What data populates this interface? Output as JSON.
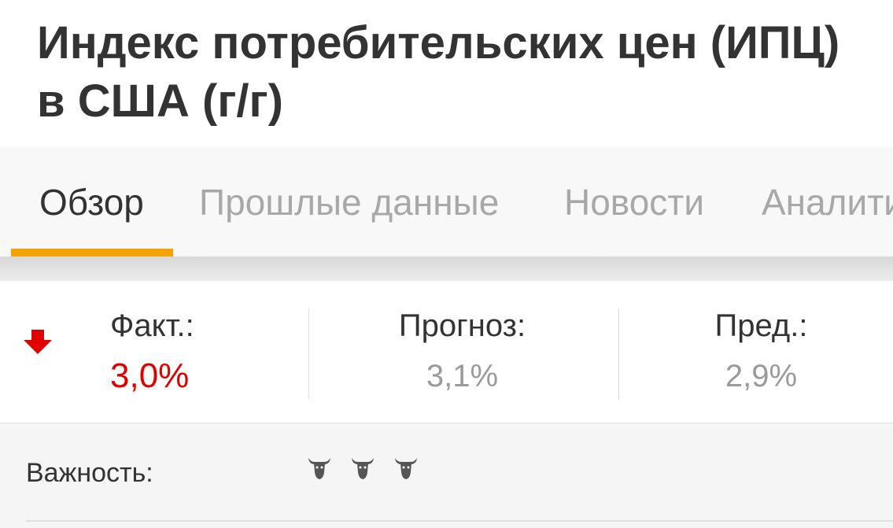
{
  "header": {
    "title_line1": "Индекс потребительских цен (ИПЦ)",
    "title_line2": "в США (г/г)"
  },
  "tabs": [
    {
      "label": "Обзор",
      "active": true
    },
    {
      "label": "Прошлые данные",
      "active": false
    },
    {
      "label": "Новости",
      "active": false
    },
    {
      "label": "Аналитика",
      "active": false
    }
  ],
  "indicator": {
    "direction_icon": "arrow-down-icon",
    "actual_label": "Факт.:",
    "actual_value": "3,0%",
    "forecast_label": "Прогноз:",
    "forecast_value": "3,1%",
    "previous_label": "Пред.:",
    "previous_value": "2,9%"
  },
  "importance": {
    "label": "Важность:",
    "level": 3,
    "max": 3,
    "icon": "bull-icon"
  },
  "colors": {
    "accent": "#f4a400",
    "negative": "#e00000",
    "muted": "#a8a8a8"
  }
}
